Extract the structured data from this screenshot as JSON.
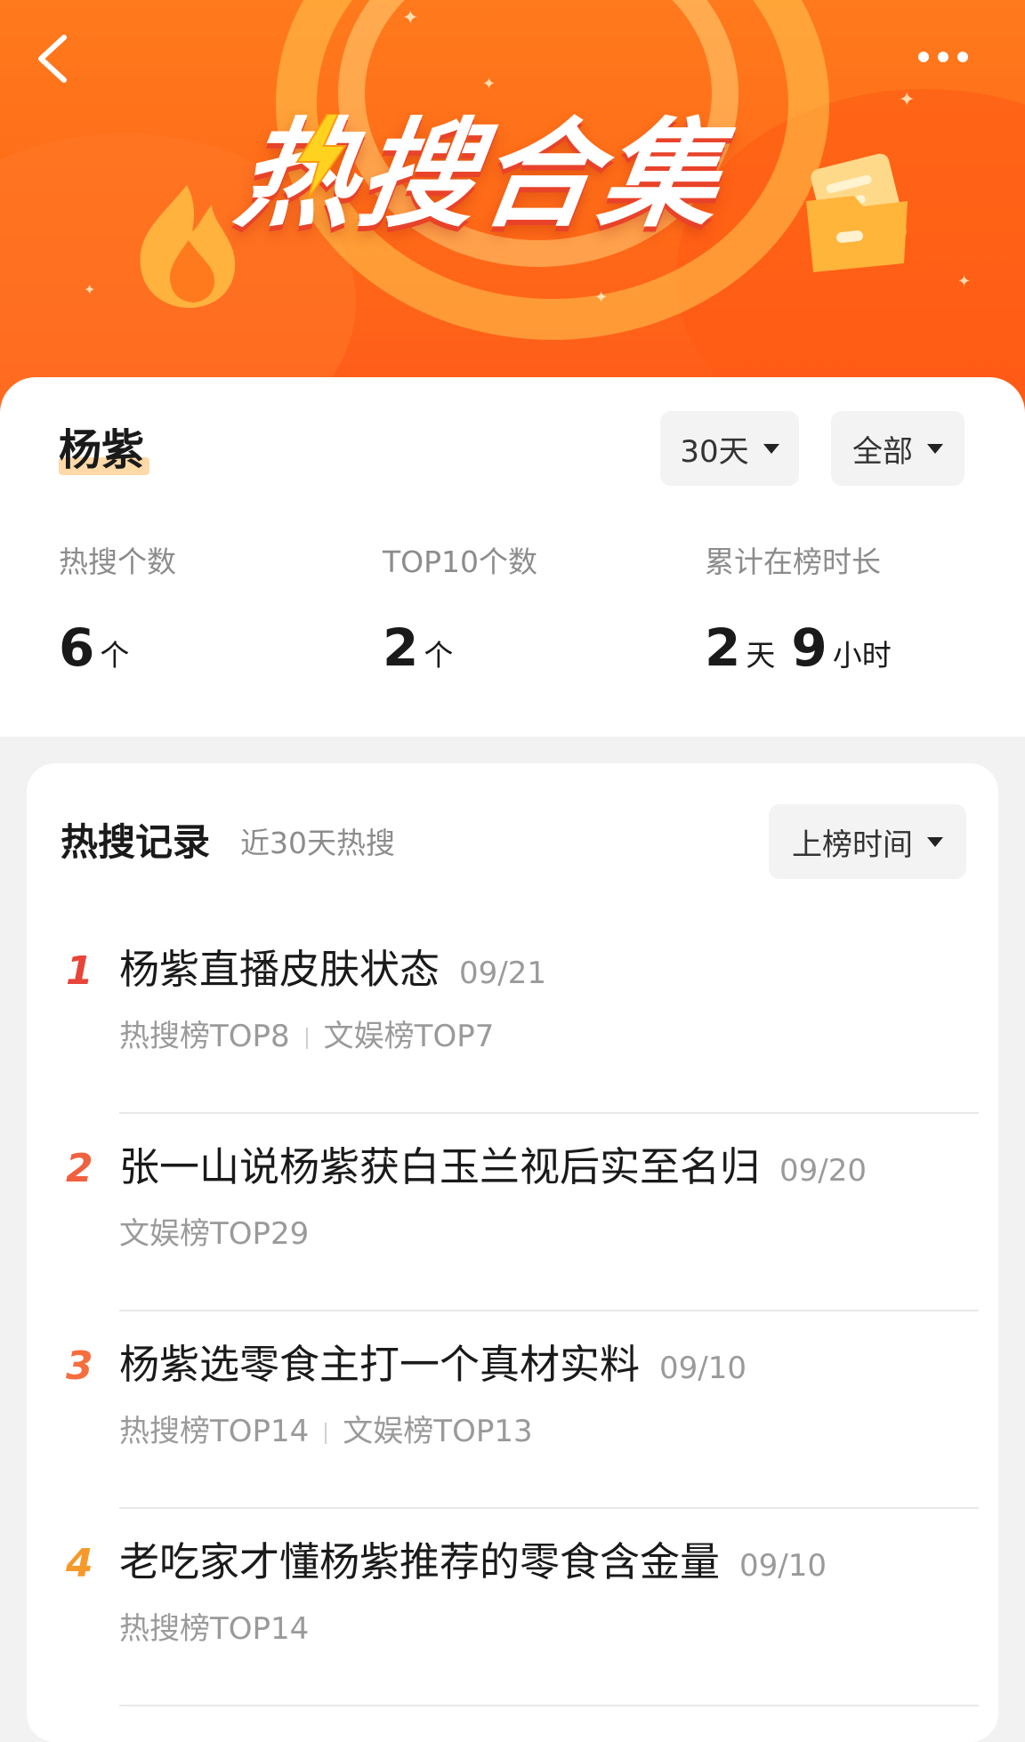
{
  "header": {
    "banner_title": "热搜合集",
    "back_icon": "back-arrow-icon",
    "more_icon": "more-dots-icon"
  },
  "summary": {
    "name": "杨紫",
    "filters": {
      "period": "30天",
      "category": "全部"
    },
    "stats": [
      {
        "label": "热搜个数",
        "value": "6",
        "unit": "个"
      },
      {
        "label": "TOP10个数",
        "value": "2",
        "unit": "个"
      },
      {
        "label": "累计在榜时长",
        "days": "2",
        "days_unit": "天",
        "hours": "9",
        "hours_unit": "小时"
      }
    ]
  },
  "records": {
    "title": "热搜记录",
    "subtitle": "近30天热搜",
    "sort_label": "上榜时间",
    "rank_colors": [
      "#e8443a",
      "#f0613f",
      "#f56e3e",
      "#f59a2a"
    ],
    "items": [
      {
        "rank": "1",
        "title": "杨紫直播皮肤状态",
        "date": "09/21",
        "tags": [
          "热搜榜TOP8",
          "文娱榜TOP7"
        ]
      },
      {
        "rank": "2",
        "title": "张一山说杨紫获白玉兰视后实至名归",
        "date": "09/20",
        "tags": [
          "文娱榜TOP29"
        ]
      },
      {
        "rank": "3",
        "title": "杨紫选零食主打一个真材实料",
        "date": "09/10",
        "tags": [
          "热搜榜TOP14",
          "文娱榜TOP13"
        ]
      },
      {
        "rank": "4",
        "title": "老吃家才懂杨紫推荐的零食含金量",
        "date": "09/10",
        "tags": [
          "热搜榜TOP14"
        ]
      }
    ]
  }
}
